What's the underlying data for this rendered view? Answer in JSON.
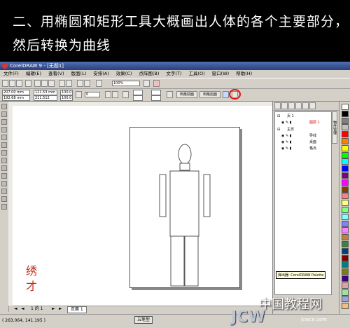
{
  "caption": {
    "line1": "二、用椭圆和矩形工具大概画出人体的各个主要部分，",
    "line2": "然后转换为曲线"
  },
  "window": {
    "title": "CorelDRAW 9 - [无题1]"
  },
  "menu": [
    "文件(F)",
    "编辑(E)",
    "查看(V)",
    "版面(L)",
    "安排(A)",
    "效果(C)",
    "点阵图(B)",
    "文字(T)",
    "工具(O)",
    "窗口(W)",
    "帮助(H)"
  ],
  "toolbar": {
    "zoom": "100%",
    "x_field": "207.00 mm",
    "y_field": "192.68 mm",
    "w_field": "121.53 mm",
    "h_field": "211.512 mm",
    "scale_w": "100.0",
    "scale_h": "100.0",
    "angle": "0",
    "to_front_label": "到最前面",
    "to_back_label": "到最后面"
  },
  "docker": {
    "vertical_tab": "物件管理",
    "tree": [
      {
        "label": "页 1",
        "red": false
      },
      {
        "label": "图层 1",
        "red": true
      },
      {
        "label": "主页",
        "red": false
      },
      {
        "label": "导线",
        "red": false
      },
      {
        "label": "桌面",
        "red": false
      },
      {
        "label": "格点",
        "red": false
      }
    ],
    "tooltip": "弹出器: CorelDRAW Palette"
  },
  "pages": {
    "nav": "1 的 1",
    "tab": "页面 1"
  },
  "status": {
    "coords": "( 263.064, 141.195 )",
    "style_button": "五笔型"
  },
  "stamp": "绣才",
  "watermark": {
    "cn": "中国教程网",
    "brand": "JCW",
    "url": "jcwcn.com"
  },
  "palette_colors": [
    "#ffffff",
    "#000000",
    "#808080",
    "#c0c0c0",
    "#ff0000",
    "#ff8000",
    "#ffff00",
    "#00ff00",
    "#00ffff",
    "#0000ff",
    "#800080",
    "#ff00ff",
    "#804000",
    "#ff8080",
    "#ffff80",
    "#80ff80",
    "#80ffff",
    "#8080ff",
    "#ff80ff",
    "#c08040",
    "#408040",
    "#004080",
    "#800000",
    "#008080",
    "#808000",
    "#400080",
    "#e0a0a0",
    "#a0e0a0",
    "#a0a0e0",
    "#f0c080"
  ]
}
